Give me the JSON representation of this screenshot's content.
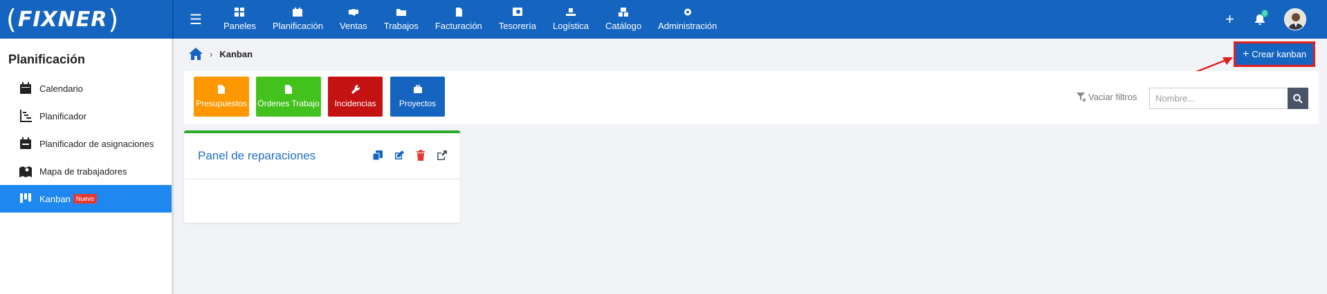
{
  "logo": {
    "text": "FIXNER"
  },
  "topnav": {
    "items": [
      {
        "label": "Paneles",
        "icon": "dashboard-icon"
      },
      {
        "label": "Planificación",
        "icon": "calendar-icon"
      },
      {
        "label": "Ventas",
        "icon": "handshake-icon"
      },
      {
        "label": "Trabajos",
        "icon": "folder-icon"
      },
      {
        "label": "Facturación",
        "icon": "invoice-icon"
      },
      {
        "label": "Tesorería",
        "icon": "safe-icon"
      },
      {
        "label": "Logística",
        "icon": "dolly-icon"
      },
      {
        "label": "Catálogo",
        "icon": "boxes-icon"
      },
      {
        "label": "Administración",
        "icon": "gear-icon"
      }
    ],
    "notification_count": "0"
  },
  "sidebar": {
    "title": "Planificación",
    "items": [
      {
        "label": "Calendario",
        "icon": "calendar-icon"
      },
      {
        "label": "Planificador",
        "icon": "chart-icon"
      },
      {
        "label": "Planificador de asignaciones",
        "icon": "calendar-check-icon"
      },
      {
        "label": "Mapa de trabajadores",
        "icon": "map-marker-icon"
      },
      {
        "label": "Kanban",
        "icon": "kanban-icon",
        "badge": "Nuevo",
        "active": true
      }
    ]
  },
  "breadcrumb": {
    "current": "Kanban"
  },
  "toolbar": {
    "create_label": "Crear kanban"
  },
  "categories": [
    {
      "label": "Presupuestos",
      "color": "#ff9800"
    },
    {
      "label": "Órdenes Trabajo",
      "color": "#43c21d"
    },
    {
      "label": "Incidencias",
      "color": "#c41212"
    },
    {
      "label": "Proyectos",
      "color": "#1565c0"
    }
  ],
  "filters": {
    "clear_label": "Vaciar filtros",
    "search_placeholder": "Nombre..."
  },
  "boards": [
    {
      "title": "Panel de reparaciones"
    }
  ],
  "colors": {
    "primary": "#1565c0",
    "highlight": "#e21f1f",
    "active": "#1e88f0"
  }
}
